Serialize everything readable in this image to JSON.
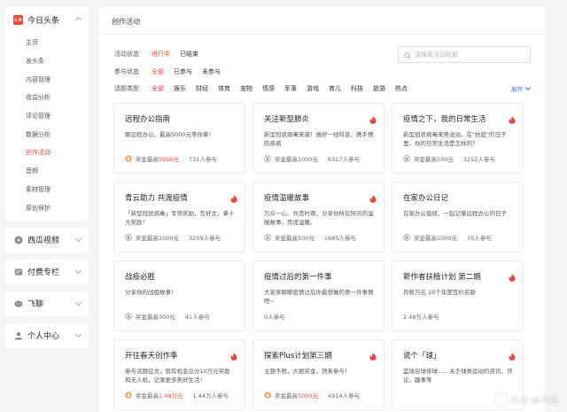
{
  "sidebar": {
    "app": {
      "name": "今日头条",
      "logo_text": "头条"
    },
    "items": [
      {
        "label": "主页"
      },
      {
        "label": "发头条"
      },
      {
        "label": "内容管理"
      },
      {
        "label": "收益分析"
      },
      {
        "label": "评论管理"
      },
      {
        "label": "数据分析"
      },
      {
        "label": "创作活动",
        "active": true
      },
      {
        "label": "音频"
      },
      {
        "label": "素材管理"
      },
      {
        "label": "原创保护"
      }
    ],
    "sections": [
      {
        "label": "西瓜视频",
        "icon": "xigua-icon"
      },
      {
        "label": "付费专栏",
        "icon": "paid-column-icon"
      },
      {
        "label": "飞聊",
        "icon": "feiliao-icon"
      },
      {
        "label": "个人中心",
        "icon": "user-icon"
      }
    ]
  },
  "main": {
    "title": "创作活动",
    "search_placeholder": "请搜索活动标题",
    "expand_label": "展开",
    "filters": {
      "status": {
        "label": "活动状态",
        "options": [
          "进行中",
          "已结束"
        ],
        "active": 0
      },
      "participation": {
        "label": "参与状态",
        "options": [
          "全部",
          "已参与",
          "未参与"
        ],
        "active": 0
      },
      "topic": {
        "label": "话题类型",
        "options": [
          "全部",
          "娱乐",
          "财经",
          "体育",
          "宠物",
          "情感",
          "军事",
          "游戏",
          "育儿",
          "科技",
          "旅游",
          "热点"
        ],
        "active": 0
      }
    },
    "cards": [
      {
        "title": "远程办公指南",
        "desc": "聊远程办公，最高5000元等你拿！",
        "prize_prefix": "奖金最高",
        "prize_amount": "5000元",
        "prize_highlight": true,
        "participants": "731人参与",
        "hot": false
      },
      {
        "title": "关注新型肺炎",
        "desc": "新型冠状病毒来袭！做好一线科普，携手预防疾病",
        "prize_prefix": "奖金最高",
        "prize_amount": "1000元",
        "prize_highlight": false,
        "participants": "6317人参与",
        "hot": true
      },
      {
        "title": "疫情之下，我的日常生活",
        "desc": "新型冠状病毒来势汹汹，在\"抗疫\"的日子里，你的日常生活是怎样的？",
        "prize_prefix": "奖金最高",
        "prize_amount": "500元",
        "prize_highlight": false,
        "participants": "3252人参与",
        "hot": true
      },
      {
        "title": "青云助力 共渡疫情",
        "desc": "「新型冠状病毒」专项奖励，写好文，拿十大奖励！",
        "prize_prefix": "奖金最高",
        "prize_amount": "1000元",
        "prize_highlight": false,
        "participants": "3209人参与",
        "hot": true
      },
      {
        "title": "疫情温暖故事",
        "desc": "万众一心、共克时艰，分享你所见所历的温暖故事，传递温暖。",
        "prize_prefix": "奖金最高",
        "prize_amount": "500元",
        "prize_highlight": false,
        "participants": "1685人参与",
        "hot": true
      },
      {
        "title": "在家办公日记",
        "desc": "在家办公值班，一起记录远程办公的日子",
        "prize_prefix": "奖金最高",
        "prize_amount": "1000元",
        "prize_highlight": false,
        "participants": "70人参与",
        "hot": false
      },
      {
        "title": "战疫必胜",
        "desc": "分享你的战疫故事！",
        "prize_prefix": "奖金最高",
        "prize_amount": "300元",
        "prize_highlight": false,
        "participants": "41人参与",
        "hot": false
      },
      {
        "title": "疫情过后的第一件事",
        "desc": "大家来聊聊疫情过后你最想做的第一件事情吧~",
        "prize_prefix": "",
        "prize_amount": "",
        "prize_highlight": false,
        "participants": "0人参与",
        "hot": false
      },
      {
        "title": "新作者扶植计划 第二期",
        "desc": "月薪万元 20个年度签约名额",
        "prize_prefix": "",
        "prize_amount": "",
        "prize_highlight": false,
        "participants": "2.48万人参与",
        "hot": true
      },
      {
        "title": "开往春天创作季",
        "desc": "参与话题征文，就有机会瓜分10万元奖励和无人机，记录更多美好生活！",
        "prize_prefix": "奖金最高",
        "prize_amount": "1.49万元",
        "prize_highlight": true,
        "participants": "1.44万人参与",
        "hot": true
      },
      {
        "title": "探索Plus计划第三期",
        "desc": "主题不限，大额奖金，快来参与！",
        "prize_prefix": "奖金最高",
        "prize_amount": "5000元",
        "prize_highlight": true,
        "participants": "4914人参与",
        "hot": true
      },
      {
        "title": "说个「球」",
        "desc": "篮球足球排球……关于球类运动的资讯、评论、趣事等",
        "prize_prefix": "",
        "prize_amount": "",
        "prize_highlight": false,
        "participants": "",
        "hot": true
      }
    ]
  },
  "watermark": {
    "text": "头条 @问答"
  },
  "colors": {
    "accent": "#e8463b",
    "link": "#3b6fd6"
  }
}
